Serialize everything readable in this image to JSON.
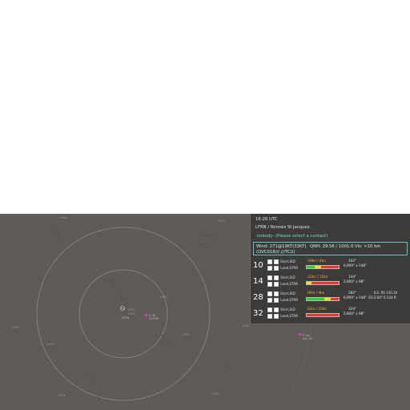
{
  "colors": {
    "radar_bg": "#5d5a58",
    "panel_bg": "#3d3b3a",
    "accent_cyan": "#5fc2c0",
    "aircraft_magenta": "#d040d0",
    "crosswind_orange": "#ffb92e",
    "bar_green": "#33cc33",
    "bar_yellow": "#e5e52e",
    "bar_red": "#e53b2e"
  },
  "map": {
    "labels": [
      "LFRR",
      "LFRZ",
      "LFRI",
      "LFRD",
      "LFRK",
      "LFRA",
      "LFRS",
      "LFRL",
      "LFRV",
      "LFRN",
      "LFRF",
      "LFRG"
    ],
    "center_label": "LFRN",
    "aircraft": [
      {
        "callsign": "F-GK",
        "info": "018 85"
      },
      {
        "callsign": "F-HA",
        "info": "041 92"
      }
    ]
  },
  "panel": {
    "time": "16:26 UTC",
    "airport": "LFRN / Rennes St Jacques",
    "controller": "-nobody- (Please select a contact)",
    "weather": {
      "wind": "Wind: 271@19KT(33KT)",
      "qnh": "QNH: 29.56 / 1001.0",
      "visibility": "Vis: >10 km",
      "clouds": "(OVC018///  ///TCU)"
    },
    "runways": [
      {
        "number": "10",
        "sid_label": "Start,SID",
        "star_label": "Land,STAR",
        "wind_comp": "-19kn / 4kn",
        "heading": "102°",
        "dimensions": "6,900\" x 148\"",
        "bar": "red"
      },
      {
        "number": "14",
        "sid_label": "Start,SID",
        "star_label": "Land,STAR",
        "wind_comp": "-12kn / 15kn",
        "heading": "144°",
        "dimensions": "2,800\" x 98\"",
        "bar": "red"
      },
      {
        "number": "28",
        "sid_label": "Start,SID",
        "star_label": "Land,STAR",
        "wind_comp": "19kn / 4kn",
        "heading": "282°",
        "dimensions": "6,900\" x 148\"",
        "ils": "ILS: RS 110.10",
        "gs": "GS:3.00° E:124 ft",
        "bar": "green"
      },
      {
        "number": "32",
        "sid_label": "Start,SID",
        "star_label": "Land,STAR",
        "wind_comp": "12kn / 15kn",
        "heading": "324°",
        "dimensions": "2,800\" x 98\"",
        "bar": "red"
      }
    ]
  }
}
